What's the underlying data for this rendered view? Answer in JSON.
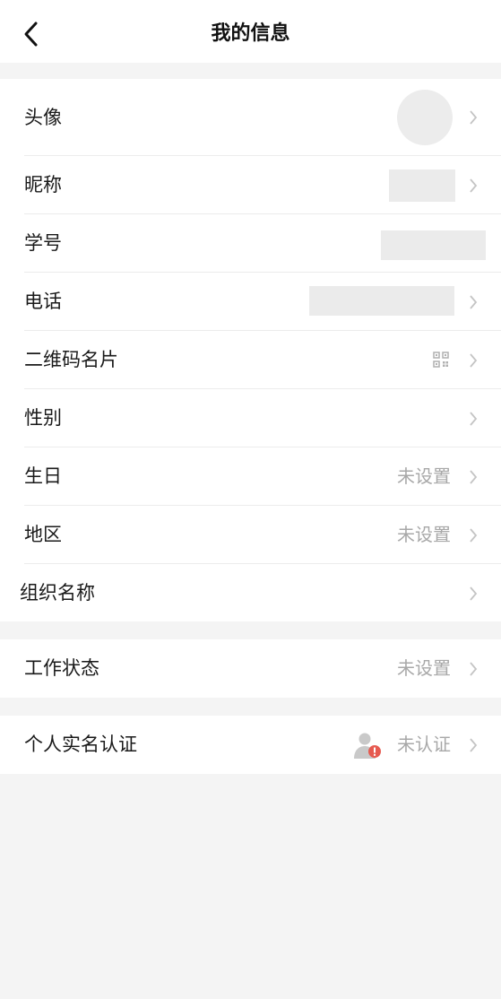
{
  "header": {
    "title": "我的信息",
    "back_icon": "chevron-left-icon"
  },
  "profile": {
    "avatar_label": "头像",
    "nickname_label": "昵称",
    "student_id_label": "学号",
    "phone_label": "电话",
    "qrcode_label": "二维码名片",
    "gender_label": "性别",
    "birthday_label": "生日",
    "birthday_value": "未设置",
    "region_label": "地区",
    "region_value": "未设置",
    "org_label": "组织名称"
  },
  "work": {
    "status_label": "工作状态",
    "status_value": "未设置"
  },
  "auth": {
    "label": "个人实名认证",
    "value": "未认证",
    "icon": "user-warning-icon"
  },
  "colors": {
    "background": "#f4f4f4",
    "value_text": "#a8a8a8",
    "warning": "#e65a50"
  }
}
